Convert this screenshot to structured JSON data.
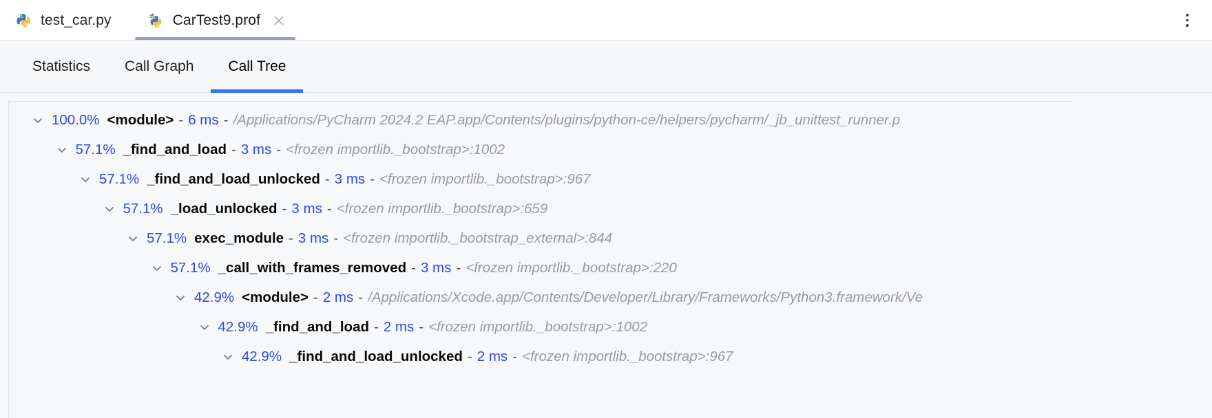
{
  "window": {
    "kebab_menu_label": "More options"
  },
  "editor_tabs": [
    {
      "label": "test_car.py",
      "icon": "python-file-icon",
      "active": false,
      "closable": false
    },
    {
      "label": "CarTest9.prof",
      "icon": "python-profiler-file-icon",
      "active": true,
      "closable": true,
      "close_icon": "close-icon"
    }
  ],
  "sub_tabs": [
    {
      "label": "Statistics",
      "active": false
    },
    {
      "label": "Call Graph",
      "active": false
    },
    {
      "label": "Call Tree",
      "active": true
    }
  ],
  "colors": {
    "accent_blue": "#3574f0",
    "value_blue": "#2f47e8",
    "location_gray": "#9a9ba0",
    "panel_bg": "#f7f8fa",
    "tab_active_bar": "#9aa0af"
  },
  "call_tree": {
    "separator": "-",
    "expander_icon": "chevron-down-icon",
    "rows": [
      {
        "depth": 0,
        "expanded": true,
        "percent": "100.0%",
        "function": "<module>",
        "time": "6 ms",
        "location": "/Applications/PyCharm 2024.2 EAP.app/Contents/plugins/python-ce/helpers/pycharm/_jb_unittest_runner.p"
      },
      {
        "depth": 1,
        "expanded": true,
        "percent": "57.1%",
        "function": "_find_and_load",
        "time": "3 ms",
        "location": "<frozen importlib._bootstrap>:1002"
      },
      {
        "depth": 2,
        "expanded": true,
        "percent": "57.1%",
        "function": "_find_and_load_unlocked",
        "time": "3 ms",
        "location": "<frozen importlib._bootstrap>:967"
      },
      {
        "depth": 3,
        "expanded": true,
        "percent": "57.1%",
        "function": "_load_unlocked",
        "time": "3 ms",
        "location": "<frozen importlib._bootstrap>:659"
      },
      {
        "depth": 4,
        "expanded": true,
        "percent": "57.1%",
        "function": "exec_module",
        "time": "3 ms",
        "location": "<frozen importlib._bootstrap_external>:844"
      },
      {
        "depth": 5,
        "expanded": true,
        "percent": "57.1%",
        "function": "_call_with_frames_removed",
        "time": "3 ms",
        "location": "<frozen importlib._bootstrap>:220"
      },
      {
        "depth": 6,
        "expanded": true,
        "percent": "42.9%",
        "function": "<module>",
        "time": "2 ms",
        "location": "/Applications/Xcode.app/Contents/Developer/Library/Frameworks/Python3.framework/Ve"
      },
      {
        "depth": 7,
        "expanded": true,
        "percent": "42.9%",
        "function": "_find_and_load",
        "time": "2 ms",
        "location": "<frozen importlib._bootstrap>:1002"
      },
      {
        "depth": 8,
        "expanded": true,
        "percent": "42.9%",
        "function": "_find_and_load_unlocked",
        "time": "2 ms",
        "location": "<frozen importlib._bootstrap>:967"
      }
    ]
  }
}
